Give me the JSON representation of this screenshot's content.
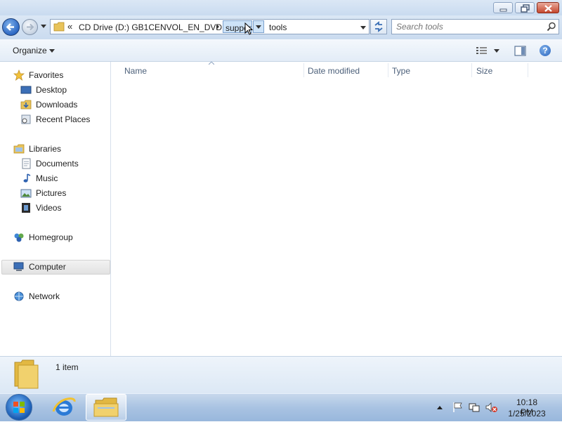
{
  "window": {
    "minimize_icon": "minimize-icon",
    "maximize_icon": "restore-icon",
    "close_icon": "close-icon"
  },
  "address": {
    "overflow": "«",
    "crumbs": [
      "CD Drive (D:) GB1CENVOL_EN_DVD",
      "support",
      "tools"
    ]
  },
  "search": {
    "placeholder": "Search tools"
  },
  "toolbar": {
    "organize": "Organize"
  },
  "nav": {
    "favorites": "Favorites",
    "desktop": "Desktop",
    "downloads": "Downloads",
    "recent_places": "Recent Places",
    "libraries": "Libraries",
    "documents": "Documents",
    "music": "Music",
    "pictures": "Pictures",
    "videos": "Videos",
    "homegroup": "Homegroup",
    "computer": "Computer",
    "network": "Network"
  },
  "columns": [
    "Name",
    "Date modified",
    "Type",
    "Size"
  ],
  "details": {
    "count": "1 item"
  },
  "taskbar": {
    "time": "10:18 PM",
    "date": "1/25/2023"
  },
  "colors": {
    "accent": "#2d68c4",
    "selection": "#cde3f8"
  }
}
